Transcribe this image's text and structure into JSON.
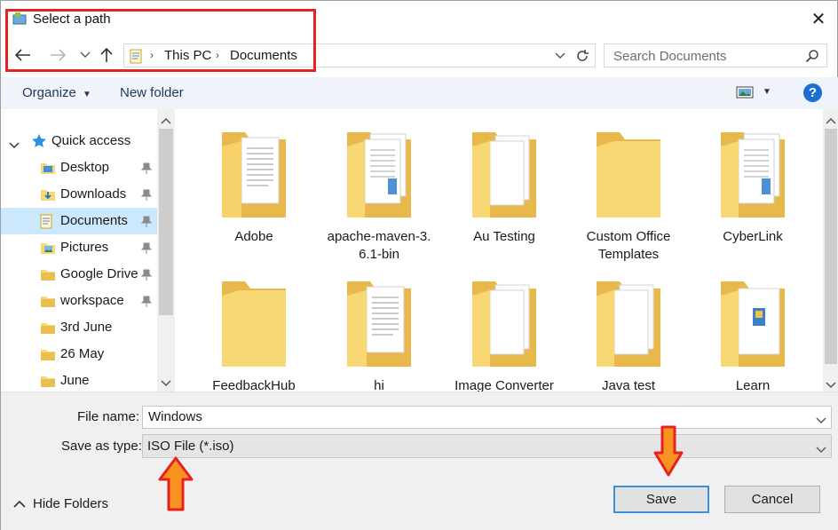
{
  "window": {
    "title": "Select a path",
    "close_glyph": "✕"
  },
  "address_bar": {
    "crumbs": [
      "This PC",
      "Documents"
    ],
    "search_placeholder": "Search Documents"
  },
  "toolbar": {
    "organize_label": "Organize",
    "new_folder_label": "New folder",
    "help_label": "?"
  },
  "nav": {
    "quick_access_label": "Quick access",
    "items": [
      {
        "label": "Desktop",
        "icon": "desktop-folder-icon",
        "pinned": true
      },
      {
        "label": "Downloads",
        "icon": "downloads-folder-icon",
        "pinned": true
      },
      {
        "label": "Documents",
        "icon": "documents-folder-icon",
        "pinned": true,
        "selected": true
      },
      {
        "label": "Pictures",
        "icon": "pictures-folder-icon",
        "pinned": true
      },
      {
        "label": "Google Drive",
        "icon": "folder-icon",
        "pinned": true
      },
      {
        "label": "workspace",
        "icon": "folder-icon",
        "pinned": true
      },
      {
        "label": "3rd June",
        "icon": "folder-icon",
        "pinned": false
      },
      {
        "label": "26 May",
        "icon": "folder-icon",
        "pinned": false
      },
      {
        "label": "June",
        "icon": "folder-icon",
        "pinned": false
      }
    ]
  },
  "content": {
    "folders": [
      {
        "name": "Adobe",
        "name2": "",
        "kind": "docs"
      },
      {
        "name": "apache-maven-3.",
        "name2": "6.1-bin",
        "kind": "pages"
      },
      {
        "name": "Au Testing",
        "name2": "",
        "kind": "white"
      },
      {
        "name": "Custom Office",
        "name2": "Templates",
        "kind": "plain"
      },
      {
        "name": "CyberLink",
        "name2": "",
        "kind": "pages"
      },
      {
        "name": "FeedbackHub",
        "name2": "",
        "kind": "plain"
      },
      {
        "name": "hi",
        "name2": "",
        "kind": "docs"
      },
      {
        "name": "Image Converter",
        "name2": "",
        "kind": "white"
      },
      {
        "name": "Java test",
        "name2": "",
        "kind": "white"
      },
      {
        "name": "Learn",
        "name2": "",
        "kind": "image"
      }
    ]
  },
  "save_form": {
    "file_name_label": "File name:",
    "file_name_value": "Windows",
    "save_type_label": "Save as type:",
    "save_type_value": "ISO File (*.iso)"
  },
  "footer": {
    "hide_folders_label": "Hide Folders",
    "save_label": "Save",
    "cancel_label": "Cancel"
  },
  "colors": {
    "highlight_red": "#e52121",
    "arrow_orange": "#f7931e",
    "selection_blue": "#cce8ff",
    "folder_yellow": "#f8d775"
  }
}
